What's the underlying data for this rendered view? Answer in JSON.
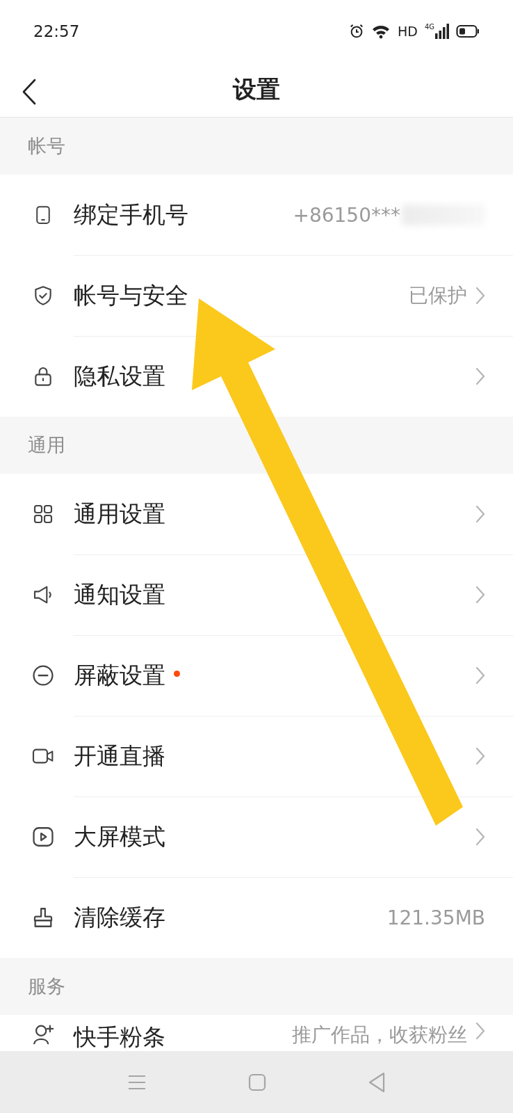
{
  "status_bar": {
    "time": "22:57",
    "network": "HD",
    "signal": "4G"
  },
  "header": {
    "title": "设置"
  },
  "sections": [
    {
      "title": "帐号",
      "rows": [
        {
          "kind": "phone",
          "label": "绑定手机号",
          "value": "+86150***",
          "redacted": true,
          "chevron": false,
          "dot": false
        },
        {
          "kind": "shield",
          "label": "帐号与安全",
          "value": "已保护",
          "redacted": false,
          "chevron": true,
          "dot": false
        },
        {
          "kind": "lock",
          "label": "隐私设置",
          "redacted": false,
          "chevron": true,
          "dot": false
        }
      ]
    },
    {
      "title": "通用",
      "rows": [
        {
          "kind": "grid",
          "label": "通用设置",
          "redacted": false,
          "chevron": true,
          "dot": false
        },
        {
          "kind": "speaker",
          "label": "通知设置",
          "redacted": false,
          "chevron": true,
          "dot": false
        },
        {
          "kind": "minus",
          "label": "屏蔽设置",
          "redacted": false,
          "chevron": true,
          "dot": true
        },
        {
          "kind": "camera",
          "label": "开通直播",
          "redacted": false,
          "chevron": true,
          "dot": false
        },
        {
          "kind": "play",
          "label": "大屏模式",
          "redacted": false,
          "chevron": true,
          "dot": false
        },
        {
          "kind": "broom",
          "label": "清除缓存",
          "value": "121.35MB",
          "redacted": false,
          "chevron": false,
          "dot": false
        }
      ]
    },
    {
      "title": "服务",
      "rows": [
        {
          "kind": "person_add",
          "label": "快手粉条",
          "value": "推广作品，收获粉丝",
          "redacted": false,
          "chevron": true,
          "dot": false,
          "partial": true
        }
      ]
    }
  ]
}
